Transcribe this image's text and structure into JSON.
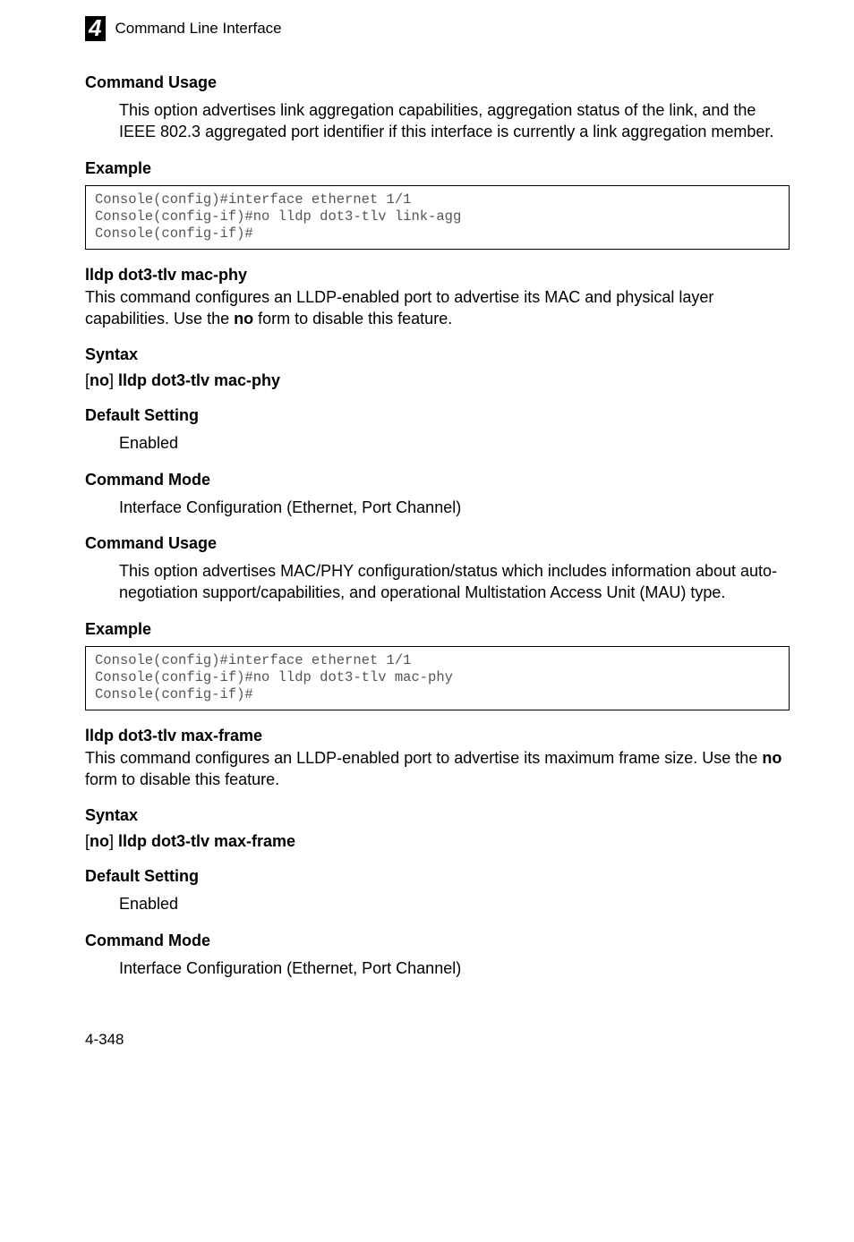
{
  "header": {
    "chapter_number": "4",
    "title": "Command Line Interface"
  },
  "sections": [
    {
      "heading": "Command Usage",
      "body": "This option advertises link aggregation capabilities, aggregation status of the link, and the IEEE 802.3 aggregated port identifier if this interface is currently a link aggregation member."
    },
    {
      "heading": "Example",
      "code": "Console(config)#interface ethernet 1/1\nConsole(config-if)#no lldp dot3-tlv link-agg\nConsole(config-if)#"
    }
  ],
  "command1": {
    "title": "lldp dot3-tlv mac-phy",
    "desc_pre": "This command configures an LLDP-enabled port to advertise its MAC and physical layer capabilities. Use the ",
    "desc_bold": "no",
    "desc_post": " form to disable this feature.",
    "syntax_heading": "Syntax",
    "syntax_bracket_open": "[",
    "syntax_no": "no",
    "syntax_bracket_close": "]",
    "syntax_cmd": " lldp dot3-tlv mac-phy",
    "default_heading": "Default Setting",
    "default_value": "Enabled",
    "mode_heading": "Command Mode",
    "mode_value": "Interface Configuration (Ethernet, Port Channel)",
    "usage_heading": "Command Usage",
    "usage_body": "This option advertises MAC/PHY configuration/status which includes information about auto-negotiation support/capabilities, and operational Multistation Access Unit (MAU) type.",
    "example_heading": "Example",
    "example_code": "Console(config)#interface ethernet 1/1\nConsole(config-if)#no lldp dot3-tlv mac-phy\nConsole(config-if)#"
  },
  "command2": {
    "title": "lldp dot3-tlv max-frame",
    "desc_pre": "This command configures an LLDP-enabled port to advertise its maximum frame size. Use the ",
    "desc_bold": "no",
    "desc_post": " form to disable this feature.",
    "syntax_heading": "Syntax",
    "syntax_bracket_open": "[",
    "syntax_no": "no",
    "syntax_bracket_close": "]",
    "syntax_cmd": " lldp dot3-tlv max-frame",
    "default_heading": "Default Setting",
    "default_value": "Enabled",
    "mode_heading": "Command Mode",
    "mode_value": "Interface Configuration (Ethernet, Port Channel)"
  },
  "footer": {
    "page": "4-348"
  }
}
